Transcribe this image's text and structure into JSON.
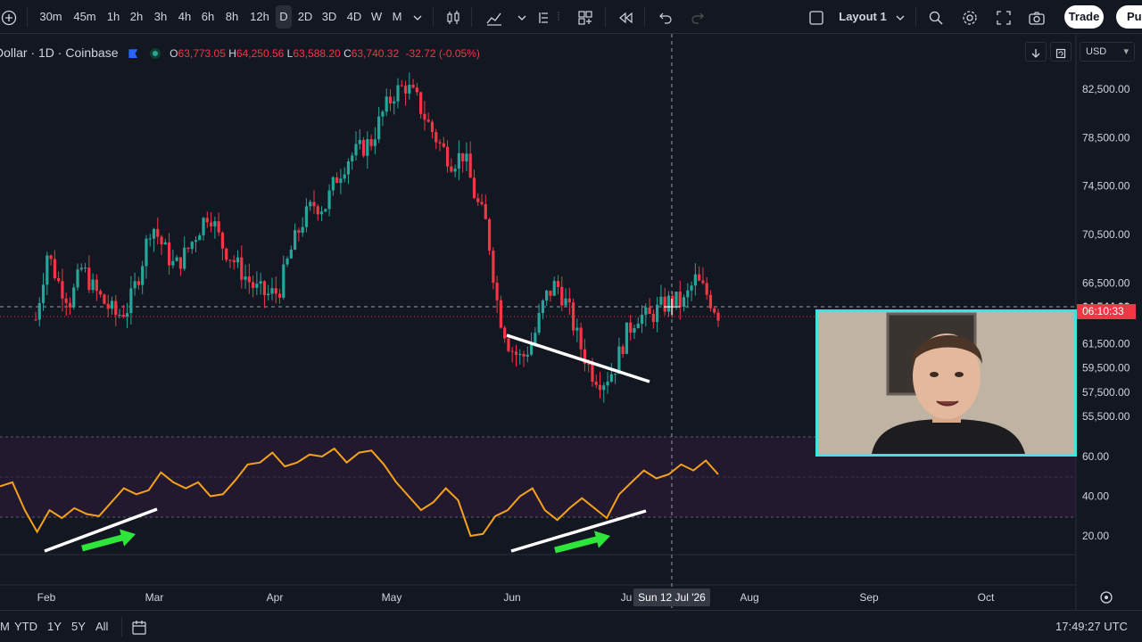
{
  "toolbar": {
    "intervals": [
      "30m",
      "45m",
      "1h",
      "2h",
      "3h",
      "4h",
      "6h",
      "8h",
      "12h",
      "D",
      "2D",
      "3D",
      "4D",
      "W",
      "M"
    ],
    "active_interval": "D",
    "layout_label": "Layout 1",
    "trade_label": "Trade",
    "publish_label": "Pu",
    "icons": [
      "add-symbol-icon",
      "chevron-down-icon",
      "candles-icon",
      "indicators-icon",
      "chevron-down-icon",
      "templates-icon",
      "layout-grid-icon",
      "replay-icon",
      "undo-icon",
      "redo-icon",
      "layout-square-icon",
      "search-icon",
      "settings-icon",
      "fullscreen-icon",
      "camera-icon"
    ]
  },
  "legend": {
    "symbol": "Dollar · 1D · Coinbase",
    "open_label": "O",
    "open": "63,773.05",
    "high_label": "H",
    "high": "64,250.56",
    "low_label": "L",
    "low": "63,588.20",
    "close_label": "C",
    "close": "63,740.32",
    "change": "-32.72 (-0.05%)"
  },
  "currency": "USD",
  "price_scale": {
    "ticks": [
      "82,500.00",
      "78,500.00",
      "74,500.00",
      "70,500.00",
      "66,500.00",
      "61,500.00",
      "59,500.00",
      "57,500.00",
      "55,500.00"
    ],
    "current_price": "64,544.93",
    "countdown": "06:10:33"
  },
  "rsi_scale": {
    "ticks": [
      "60.00",
      "40.00",
      "20.00"
    ]
  },
  "time_axis": {
    "labels": [
      "Feb",
      "Mar",
      "Apr",
      "May",
      "Jun",
      "Ju",
      "Aug",
      "Sep",
      "Oct"
    ],
    "crosshair_label": "Sun 12 Jul '26"
  },
  "bottom_bar": {
    "ranges": [
      "M",
      "YTD",
      "1Y",
      "5Y",
      "All"
    ],
    "time": "17:49:27 UTC"
  },
  "colors": {
    "up": "#26a69a",
    "down": "#f23645",
    "rsi": "#f7a21b",
    "background": "#131722",
    "webcam_border": "#3ee4e0",
    "arrow": "#2ee63a"
  },
  "chart_data": {
    "type": "candlestick",
    "price_range": [
      54000,
      84500
    ],
    "rsi_range": [
      10,
      70
    ],
    "price_path": [
      63500,
      69000,
      66500,
      65000,
      67800,
      66000,
      64800,
      63800,
      64500,
      67500,
      71500,
      69500,
      67800,
      69000,
      70800,
      72500,
      69800,
      68500,
      67200,
      66000,
      65500,
      65800,
      69000,
      71500,
      73000,
      72800,
      75200,
      76800,
      77500,
      78200,
      80500,
      82200,
      82800,
      81500,
      79500,
      77800,
      76500,
      77200,
      73500,
      71200,
      64200,
      61200,
      60200,
      61800,
      65200,
      66500,
      64500,
      61500,
      59200,
      58400,
      59400,
      62200,
      63900,
      63600,
      64500,
      65100,
      64800,
      66800,
      65600,
      64000
    ],
    "rsi_path": [
      45,
      47,
      33,
      22,
      33,
      29,
      34,
      31,
      30,
      37,
      44,
      41,
      43,
      52,
      47,
      44,
      47,
      40,
      41,
      48,
      56,
      57,
      62,
      55,
      57,
      61,
      60,
      64,
      57,
      62,
      63,
      56,
      47,
      40,
      33,
      37,
      44,
      38,
      20,
      21,
      30,
      33,
      40,
      44,
      33,
      28,
      34,
      39,
      34,
      29,
      41,
      47,
      53,
      49,
      51,
      56,
      53,
      58,
      51
    ]
  }
}
